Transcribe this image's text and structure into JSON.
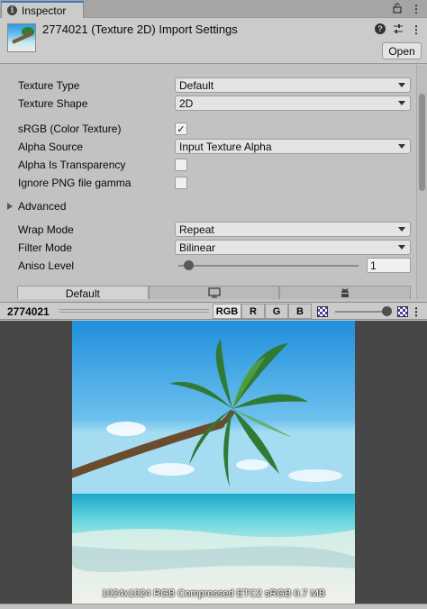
{
  "tab": {
    "label": "Inspector"
  },
  "header": {
    "title": "2774021 (Texture 2D) Import Settings",
    "open_label": "Open"
  },
  "settings": {
    "texture_type": {
      "label": "Texture Type",
      "value": "Default"
    },
    "texture_shape": {
      "label": "Texture Shape",
      "value": "2D"
    },
    "srgb": {
      "label": "sRGB (Color Texture)",
      "checked": true,
      "check_glyph": "✓"
    },
    "alpha_source": {
      "label": "Alpha Source",
      "value": "Input Texture Alpha"
    },
    "alpha_is_transparency": {
      "label": "Alpha Is Transparency",
      "checked": false
    },
    "ignore_png_gamma": {
      "label": "Ignore PNG file gamma",
      "checked": false
    },
    "advanced": {
      "label": "Advanced"
    },
    "wrap_mode": {
      "label": "Wrap Mode",
      "value": "Repeat"
    },
    "filter_mode": {
      "label": "Filter Mode",
      "value": "Bilinear"
    },
    "aniso_level": {
      "label": "Aniso Level",
      "value": "1"
    }
  },
  "platform_tabs": [
    {
      "label": "Default",
      "icon": "monitor-icon"
    },
    {
      "label": "",
      "icon": "monitor-icon"
    },
    {
      "label": "",
      "icon": "android-icon"
    }
  ],
  "preview": {
    "name": "2774021",
    "channels": [
      "RGB",
      "R",
      "G",
      "B"
    ],
    "caption": "1024x1024  RGB Compressed ETC2 sRGB   0.7 MB"
  },
  "icons": {
    "tab": "info-icon",
    "lock": "lock-icon",
    "menu": "kebab-menu-icon",
    "help": "help-icon",
    "presets": "sliders-icon"
  },
  "colors": {
    "tab_accent": "#3a79bb",
    "checker_purple": "#5b3aa8"
  }
}
